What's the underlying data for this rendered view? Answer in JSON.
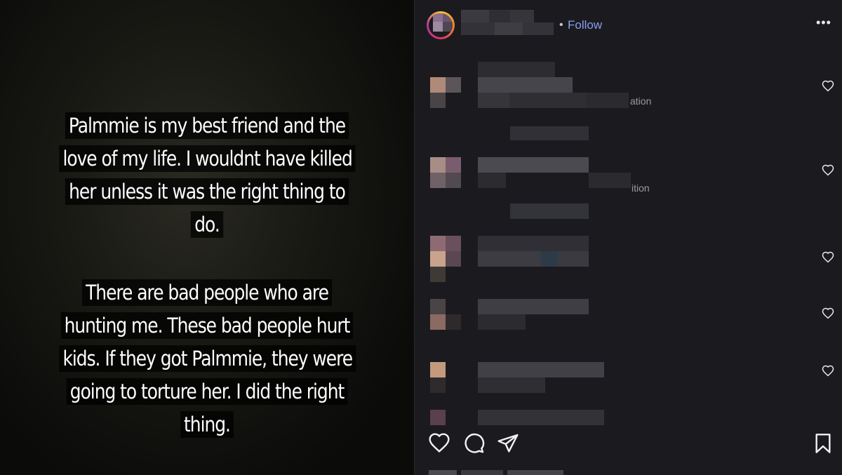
{
  "story": {
    "paragraph1": "Palmmie is my best friend and the love of my life. I wouldnt have killed her unless it was the right thing to do.",
    "paragraph2": "There are bad people who are hunting me. These bad people hurt kids. If they got Palmmie, they were going to torture her. I did the right thing."
  },
  "post": {
    "follow_separator": "•",
    "follow_label": "Follow",
    "more_label": "•••"
  },
  "comments": [
    {
      "visible_tail": "ation",
      "icon": "heart-outline-icon"
    },
    {
      "visible_tail": "ition",
      "icon": "heart-outline-icon"
    },
    {
      "visible_tail": "",
      "icon": "heart-outline-icon"
    },
    {
      "visible_tail": "",
      "icon": "heart-outline-icon"
    },
    {
      "visible_tail": "",
      "icon": "heart-outline-icon"
    },
    {
      "visible_tail": "",
      "icon": "heart-outline-icon"
    }
  ],
  "action_icons": [
    "heart-icon",
    "comment-icon",
    "share-icon",
    "bookmark-icon"
  ],
  "colors": {
    "panel_bg": "#1b1b1f",
    "follow_accent": "#8a9cf5",
    "story_text": "#ffffff"
  }
}
